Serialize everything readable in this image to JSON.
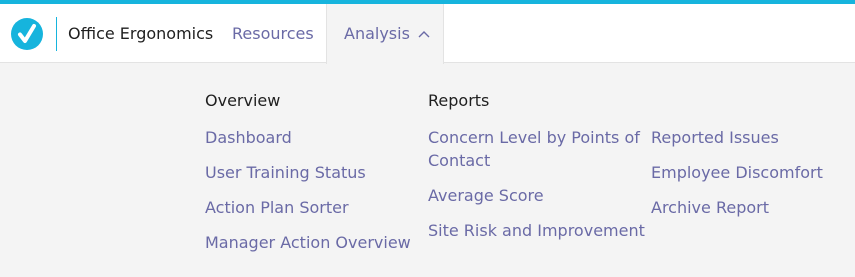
{
  "app": {
    "title": "Office Ergonomics"
  },
  "nav": {
    "resources_label": "Resources",
    "analysis_label": "Analysis"
  },
  "menu": {
    "overview": {
      "heading": "Overview",
      "links": [
        "Dashboard",
        "User Training Status",
        "Action Plan Sorter",
        "Manager Action Overview"
      ]
    },
    "reports": {
      "heading": "Reports",
      "links": [
        "Concern Level by Points of Contact",
        "Average Score",
        "Site Risk and Improvement"
      ]
    },
    "more_reports": {
      "links": [
        "Reported Issues",
        "Employee Discomfort",
        "Archive Report"
      ]
    }
  },
  "colors": {
    "brand": "#16b4dd",
    "link": "#6a6aa6",
    "text": "#1f1f1f",
    "panel": "#f4f4f4"
  },
  "icons": {
    "logo": "checkmark-logo-icon",
    "analysis_toggle": "chevron-up-icon"
  }
}
